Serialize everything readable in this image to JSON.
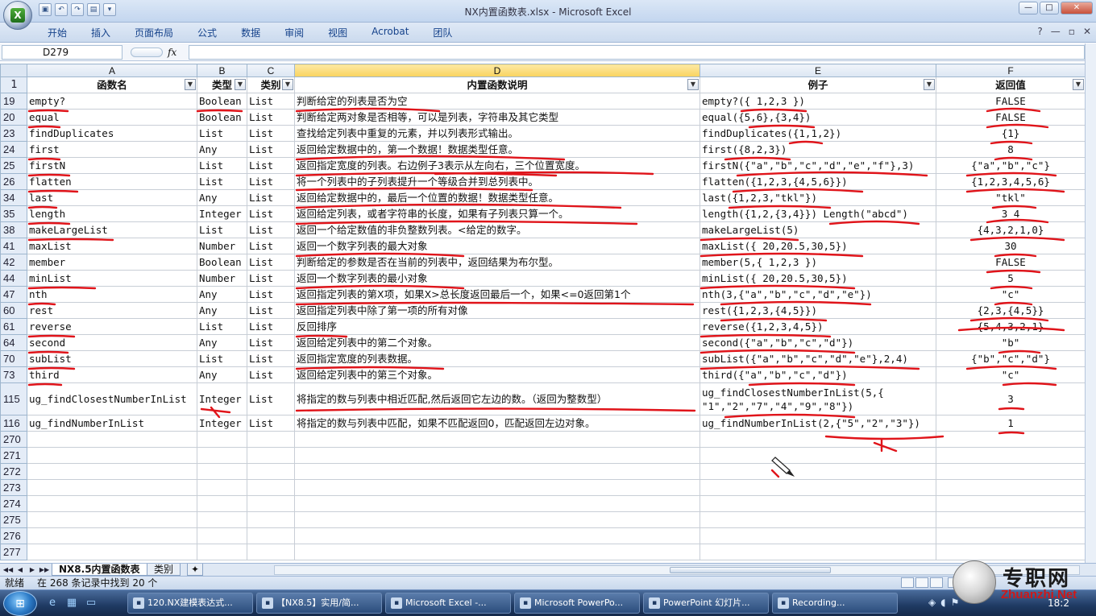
{
  "window": {
    "title": "NX内置函数表.xlsx - Microsoft Excel",
    "controls": {
      "minimize": "—",
      "maximize": "□",
      "close": "✕"
    }
  },
  "ribbon": {
    "tabs": [
      "开始",
      "插入",
      "页面布局",
      "公式",
      "数据",
      "审阅",
      "视图",
      "Acrobat",
      "团队"
    ],
    "help": "?"
  },
  "formula_bar": {
    "name_box": "D279",
    "fx": "fx",
    "content": ""
  },
  "columns": [
    "A",
    "B",
    "C",
    "D",
    "E",
    "F"
  ],
  "header_row": {
    "row_num": "1",
    "cells": [
      "函数名",
      "类型",
      "类别",
      "内置函数说明",
      "例子",
      "返回值"
    ],
    "filter_icons": [
      "▼",
      "▼",
      "▼",
      "▼",
      "▼",
      "▼"
    ]
  },
  "rows": [
    {
      "n": "19",
      "a": "empty?",
      "b": "Boolean",
      "c": "List",
      "d": "判断给定的列表是否为空",
      "e": "empty?({ 1,2,3 })",
      "f": "FALSE"
    },
    {
      "n": "20",
      "a": "equal",
      "b": "Boolean",
      "c": "List",
      "d": "判断给定两对象是否相等，可以是列表，字符串及其它类型",
      "e": "equal({5,6},{3,4})",
      "f": "FALSE"
    },
    {
      "n": "23",
      "a": "findDuplicates",
      "b": "List",
      "c": "List",
      "d": "查找给定列表中重复的元素，并以列表形式输出。",
      "e": "findDuplicates({1,1,2})",
      "f": "{1}"
    },
    {
      "n": "24",
      "a": "first",
      "b": "Any",
      "c": "List",
      "d": "返回给定数据中的，第一个数据！数据类型任意。",
      "e": "first({8,2,3})",
      "f": "8"
    },
    {
      "n": "25",
      "a": "firstN",
      "b": "List",
      "c": "List",
      "d": "返回指定宽度的列表。右边例子3表示从左向右，三个位置宽度。",
      "e": "firstN({\"a\",\"b\",\"c\",\"d\",\"e\",\"f\"},3)",
      "f": "{\"a\",\"b\",\"c\"}"
    },
    {
      "n": "26",
      "a": "flatten",
      "b": "List",
      "c": "List",
      "d": "将一个列表中的子列表提升一个等级合并到总列表中。",
      "e": "flatten({1,2,3,{4,5,6}})",
      "f": "{1,2,3,4,5,6}"
    },
    {
      "n": "34",
      "a": "last",
      "b": "Any",
      "c": "List",
      "d": "返回给定数据中的，最后一个位置的数据！数据类型任意。",
      "e": "last({1,2,3,\"tkl\"})",
      "f": "\"tkl\""
    },
    {
      "n": "35",
      "a": "length",
      "b": "Integer",
      "c": "List",
      "d": "返回给定列表，或者字符串的长度，如果有子列表只算一个。",
      "e": "length({1,2,{3,4}}) Length(\"abcd\")",
      "f": "3    4"
    },
    {
      "n": "38",
      "a": "makeLargeList",
      "b": "List",
      "c": "List",
      "d": "返回一个给定数值的非负整数列表。<给定的数字。",
      "e": "makeLargeList(5)",
      "f": "{4,3,2,1,0}"
    },
    {
      "n": "41",
      "a": "maxList",
      "b": "Number",
      "c": "List",
      "d": "返回一个数字列表的最大对象",
      "e": "maxList({ 20,20.5,30,5})",
      "f": "30"
    },
    {
      "n": "42",
      "a": "member",
      "b": "Boolean",
      "c": "List",
      "d": "判断给定的参数是否在当前的列表中，返回结果为布尔型。",
      "e": "member(5,{ 1,2,3 })",
      "f": "FALSE"
    },
    {
      "n": "44",
      "a": "minList",
      "b": "Number",
      "c": "List",
      "d": "返回一个数字列表的最小对象",
      "e": "minList({ 20,20.5,30,5})",
      "f": "5"
    },
    {
      "n": "47",
      "a": "nth",
      "b": "Any",
      "c": "List",
      "d": "返回指定列表的第X项，如果X>总长度返回最后一个，如果<=0返回第1个",
      "e": "nth(3,{\"a\",\"b\",\"c\",\"d\",\"e\"})",
      "f": "\"c\""
    },
    {
      "n": "60",
      "a": "rest",
      "b": "Any",
      "c": "List",
      "d": "返回指定列表中除了第一项的所有对像",
      "e": "rest({1,2,3,{4,5}})",
      "f": "{2,3,{4,5}}"
    },
    {
      "n": "61",
      "a": "reverse",
      "b": "List",
      "c": "List",
      "d": "反回排序",
      "e": "reverse({1,2,3,4,5})",
      "f": "{5,4,3,2,1}"
    },
    {
      "n": "64",
      "a": "second",
      "b": "Any",
      "c": "List",
      "d": "返回给定列表中的第二个对象。",
      "e": "second({\"a\",\"b\",\"c\",\"d\"})",
      "f": "\"b\""
    },
    {
      "n": "70",
      "a": "subList",
      "b": "List",
      "c": "List",
      "d": "返回指定宽度的列表数据。",
      "e": "subList({\"a\",\"b\",\"c\",\"d\",\"e\"},2,4)",
      "f": "{\"b\",\"c\",\"d\"}"
    },
    {
      "n": "73",
      "a": "third",
      "b": "Any",
      "c": "List",
      "d": "返回给定列表中的第三个对象。",
      "e": "third({\"a\",\"b\",\"c\",\"d\"})",
      "f": "\"c\""
    },
    {
      "n": "115",
      "a": "ug_findClosestNumberInList",
      "b": "Integer",
      "c": "List",
      "d": "将指定的数与列表中相近匹配,然后返回它左边的数。（返回为整数型）",
      "e": "ug_findClosestNumberInList(5,{ \"1\",\"2\",\"7\",\"4\",\"9\",\"8\"})",
      "f": "3"
    },
    {
      "n": "116",
      "a": "ug_findNumberInList",
      "b": "Integer",
      "c": "List",
      "d": "将指定的数与列表中匹配，如果不匹配返回0，匹配返回左边对象。",
      "e": "ug_findNumberInList(2,{\"5\",\"2\",\"3\"})",
      "f": "1"
    }
  ],
  "empty_rows": [
    "270",
    "271",
    "272",
    "273",
    "274",
    "275",
    "276",
    "277"
  ],
  "sheet_tabs": {
    "active": "NX8.5内置函数表",
    "other": "类别",
    "nav": [
      "◀◀",
      "◀",
      "▶",
      "▶▶"
    ]
  },
  "status": {
    "ready": "就绪",
    "find": "在 268 条记录中找到 20 个"
  },
  "taskbar": {
    "tasks": [
      {
        "icon": "folder-icon",
        "label": "120.NX建模表达式..."
      },
      {
        "icon": "browser-icon",
        "label": "【NX8.5】实用/简..."
      },
      {
        "icon": "excel-icon",
        "label": "Microsoft Excel -..."
      },
      {
        "icon": "powerpoint-icon",
        "label": "Microsoft PowerPo..."
      },
      {
        "icon": "slideshow-icon",
        "label": "PowerPoint 幻灯片..."
      },
      {
        "icon": "recording-icon",
        "label": "Recording..."
      }
    ],
    "clock": "18:2"
  },
  "watermark": {
    "text": "专职网",
    "url": "Zhuanzhi.Net"
  },
  "colors": {
    "accent": "#15428b",
    "annotation": "#e0141a",
    "selected_col": "#f9d35e"
  }
}
